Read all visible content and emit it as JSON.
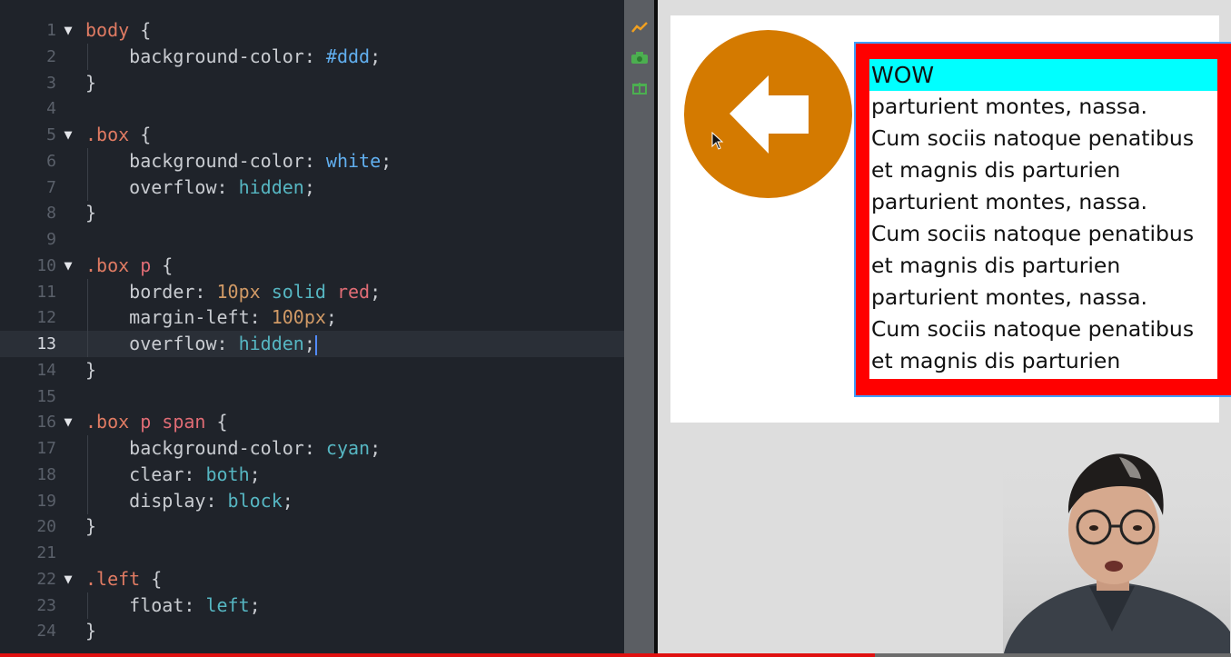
{
  "editor": {
    "active_line": 13,
    "lines": [
      {
        "n": "1",
        "fold": true,
        "tokens": [
          [
            "sel",
            "body"
          ],
          [
            "punc",
            " {"
          ]
        ]
      },
      {
        "n": "2",
        "indent": true,
        "tokens": [
          [
            "prop",
            "    background-color: "
          ],
          [
            "valb",
            "#ddd"
          ],
          [
            "punc",
            ";"
          ]
        ]
      },
      {
        "n": "3",
        "tokens": [
          [
            "punc",
            "}"
          ]
        ]
      },
      {
        "n": "4",
        "tokens": []
      },
      {
        "n": "5",
        "fold": true,
        "tokens": [
          [
            "sel",
            ".box"
          ],
          [
            "punc",
            " {"
          ]
        ]
      },
      {
        "n": "6",
        "indent": true,
        "tokens": [
          [
            "prop",
            "    background-color: "
          ],
          [
            "valb",
            "white"
          ],
          [
            "punc",
            ";"
          ]
        ]
      },
      {
        "n": "7",
        "indent": true,
        "tokens": [
          [
            "prop",
            "    overflow: "
          ],
          [
            "val",
            "hidden"
          ],
          [
            "punc",
            ";"
          ]
        ]
      },
      {
        "n": "8",
        "tokens": [
          [
            "punc",
            "}"
          ]
        ]
      },
      {
        "n": "9",
        "tokens": []
      },
      {
        "n": "10",
        "fold": true,
        "tokens": [
          [
            "sel",
            ".box "
          ],
          [
            "el",
            "p"
          ],
          [
            "punc",
            " {"
          ]
        ]
      },
      {
        "n": "11",
        "indent": true,
        "tokens": [
          [
            "prop",
            "    border: "
          ],
          [
            "num",
            "10px"
          ],
          [
            "val",
            " solid "
          ],
          [
            "el",
            "red"
          ],
          [
            "punc",
            ";"
          ]
        ]
      },
      {
        "n": "12",
        "indent": true,
        "tokens": [
          [
            "prop",
            "    margin-left: "
          ],
          [
            "num",
            "100px"
          ],
          [
            "punc",
            ";"
          ]
        ]
      },
      {
        "n": "13",
        "indent": true,
        "cursor": true,
        "tokens": [
          [
            "prop",
            "    overflow: "
          ],
          [
            "val",
            "hidden"
          ],
          [
            "punc",
            ";"
          ]
        ]
      },
      {
        "n": "14",
        "tokens": [
          [
            "punc",
            "}"
          ]
        ]
      },
      {
        "n": "15",
        "tokens": []
      },
      {
        "n": "16",
        "fold": true,
        "tokens": [
          [
            "sel",
            ".box "
          ],
          [
            "el",
            "p span"
          ],
          [
            "punc",
            " {"
          ]
        ]
      },
      {
        "n": "17",
        "indent": true,
        "tokens": [
          [
            "prop",
            "    background-color: "
          ],
          [
            "val",
            "cyan"
          ],
          [
            "punc",
            ";"
          ]
        ]
      },
      {
        "n": "18",
        "indent": true,
        "tokens": [
          [
            "prop",
            "    clear: "
          ],
          [
            "val",
            "both"
          ],
          [
            "punc",
            ";"
          ]
        ]
      },
      {
        "n": "19",
        "indent": true,
        "tokens": [
          [
            "prop",
            "    display: "
          ],
          [
            "val",
            "block"
          ],
          [
            "punc",
            ";"
          ]
        ]
      },
      {
        "n": "20",
        "tokens": [
          [
            "punc",
            "}"
          ]
        ]
      },
      {
        "n": "21",
        "tokens": []
      },
      {
        "n": "22",
        "fold": true,
        "tokens": [
          [
            "sel",
            ".left"
          ],
          [
            "punc",
            " {"
          ]
        ]
      },
      {
        "n": "23",
        "indent": true,
        "tokens": [
          [
            "prop",
            "    float: "
          ],
          [
            "val",
            "left"
          ],
          [
            "punc",
            ";"
          ]
        ]
      },
      {
        "n": "24",
        "tokens": [
          [
            "punc",
            "}"
          ]
        ]
      }
    ]
  },
  "preview": {
    "span_text": "WOW",
    "paragraph_lines": [
      "parturient montes, nassa.",
      "Cum sociis natoque penatibus",
      "et magnis dis parturien",
      "parturient montes, nassa.",
      "Cum sociis natoque penatibus",
      "et magnis dis parturien",
      "parturient montes, nassa.",
      "Cum sociis natoque penatibus",
      "et magnis dis parturien"
    ],
    "circle_color": "#d47a00",
    "border_color": "#ff0000",
    "span_color": "#00ffff"
  },
  "icons": {
    "strip": [
      "chart-icon",
      "camera-icon",
      "gift-icon"
    ],
    "arrow": "arrow-left-icon",
    "pointer": "mouse-pointer-icon"
  },
  "video": {
    "progress": 0.711
  }
}
